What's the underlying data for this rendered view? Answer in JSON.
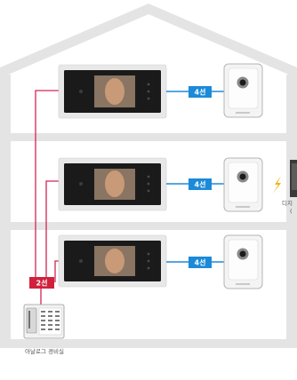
{
  "floors": [
    {
      "wire_label": "4선"
    },
    {
      "wire_label": "4선"
    },
    {
      "wire_label": "4선"
    }
  ],
  "guard_wire_label": "2선",
  "guard_room_caption": "아날로그 경비실",
  "right_caption_line1": "디지",
  "right_caption_line2": "(",
  "colors": {
    "house": "#e4e4e4",
    "wire_blue": "#1f8ad6",
    "label_blue": "#1b8ad8",
    "wire_pink": "#d42454",
    "label_red": "#d0203c",
    "spark": "#f0b419",
    "monitor_frame": "#1a1a1a",
    "monitor_bezel": "#e8e8e8"
  },
  "icons": {
    "spark": "lightning-bolt-icon",
    "door_camera": "door-camera-icon",
    "video_monitor": "video-monitor-icon",
    "guard_console": "guard-console-icon"
  }
}
